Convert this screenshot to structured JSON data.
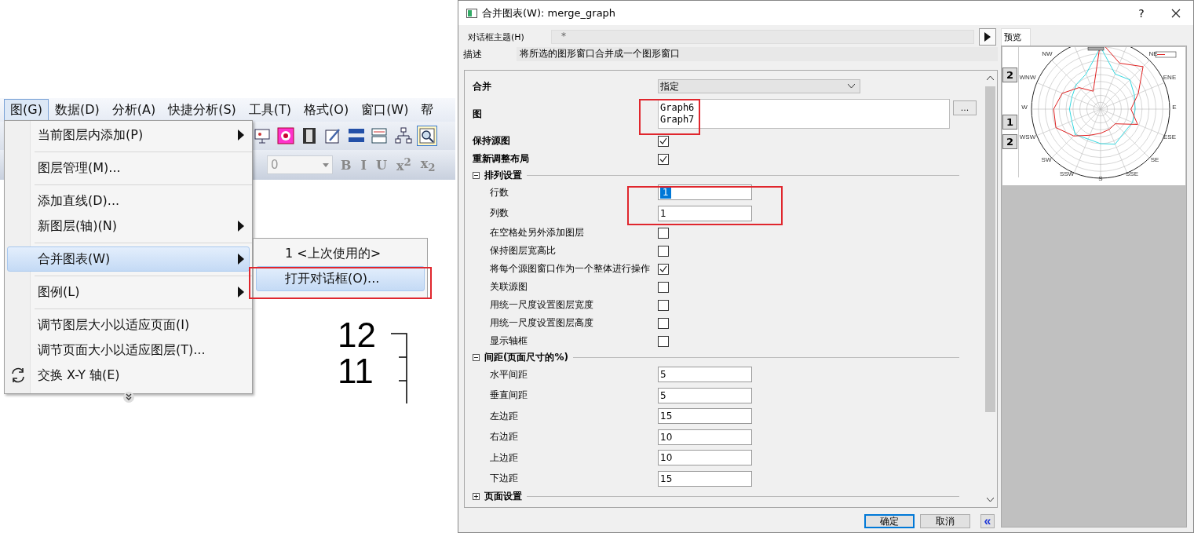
{
  "origin_screenshot": {
    "menu_bar": [
      {
        "label": "图(G)",
        "selected": true
      },
      {
        "label": "数据(D)",
        "selected": false
      },
      {
        "label": "分析(A)",
        "selected": false
      },
      {
        "label": "快捷分析(S)",
        "selected": false
      },
      {
        "label": "工具(T)",
        "selected": false
      },
      {
        "label": "格式(O)",
        "selected": false
      },
      {
        "label": "窗口(W)",
        "selected": false
      },
      {
        "label": "帮",
        "selected": false
      }
    ],
    "font_size_field": "0",
    "format_buttons": [
      "B",
      "I",
      "U",
      "x$^{2}$",
      "x$_{2}$"
    ],
    "graph_menu": [
      {
        "kind": "item",
        "label": "当前图层内添加(P)",
        "submenu": true,
        "selected": false
      },
      {
        "kind": "separator"
      },
      {
        "kind": "item",
        "label": "图层管理(M)...",
        "submenu": false,
        "selected": false
      },
      {
        "kind": "separator"
      },
      {
        "kind": "item",
        "label": "添加直线(D)...",
        "submenu": false,
        "selected": false
      },
      {
        "kind": "item",
        "label": "新图层(轴)(N)",
        "submenu": true,
        "selected": false
      },
      {
        "kind": "separator"
      },
      {
        "kind": "item",
        "label": "合并图表(W)",
        "submenu": true,
        "selected": true
      },
      {
        "kind": "separator"
      },
      {
        "kind": "item",
        "label": "图例(L)",
        "submenu": true,
        "selected": false
      },
      {
        "kind": "separator"
      },
      {
        "kind": "item",
        "label": "调节图层大小以适应页面(I)",
        "submenu": false,
        "selected": false
      },
      {
        "kind": "item",
        "label": "调节页面大小以适应图层(T)...",
        "submenu": false,
        "selected": false
      },
      {
        "kind": "iconitem",
        "label": "交换 X-Y 轴(E)",
        "submenu": false,
        "selected": false
      },
      {
        "kind": "more"
      }
    ],
    "submenu": [
      {
        "label": "1 <上次使用的>",
        "selected": false
      },
      {
        "label": "打开对话框(O)...",
        "selected": true
      }
    ],
    "axis_labels": [
      "12",
      "11"
    ]
  },
  "dialog": {
    "title": "合并图表(W): merge_graph",
    "help": "?",
    "theme_label": "对话框主题(H)",
    "theme_value": "*",
    "description_label": "描述",
    "description": "将所选的图形窗口合并成一个图形窗口",
    "settings": [
      {
        "kind": "dropdown",
        "label": "合并",
        "value": "指定"
      },
      {
        "kind": "list",
        "label": "图",
        "items": [
          "Graph6",
          "Graph7"
        ],
        "button": "..."
      },
      {
        "kind": "checkbox",
        "label": "保持源图",
        "bold": true,
        "checked": true
      },
      {
        "kind": "checkbox",
        "label": "重新调整布局",
        "bold": true,
        "checked": true
      },
      {
        "kind": "section",
        "label": "排列设置",
        "expanded": true
      },
      {
        "kind": "input",
        "label": "行数",
        "value": "1",
        "text_selected": true
      },
      {
        "kind": "input",
        "label": "列数",
        "value": "1",
        "text_selected": false
      },
      {
        "kind": "checkbox",
        "label": "在空格处另外添加图层",
        "bold": false,
        "checked": false
      },
      {
        "kind": "checkbox",
        "label": "保持图层宽高比",
        "bold": false,
        "checked": false
      },
      {
        "kind": "checkbox",
        "label": "将每个源图窗口作为一个整体进行操作",
        "bold": false,
        "checked": true
      },
      {
        "kind": "checkbox",
        "label": "关联源图",
        "bold": false,
        "checked": false
      },
      {
        "kind": "checkbox",
        "label": "用统一尺度设置图层宽度",
        "bold": false,
        "checked": false
      },
      {
        "kind": "checkbox",
        "label": "用统一尺度设置图层高度",
        "bold": false,
        "checked": false
      },
      {
        "kind": "checkbox",
        "label": "显示轴框",
        "bold": false,
        "checked": false
      },
      {
        "kind": "section",
        "label": "间距(页面尺寸的%)",
        "expanded": true
      },
      {
        "kind": "input",
        "label": "水平间距",
        "value": "5",
        "text_selected": false
      },
      {
        "kind": "input",
        "label": "垂直间距",
        "value": "5",
        "text_selected": false
      },
      {
        "kind": "input",
        "label": "左边距",
        "value": "15",
        "text_selected": false
      },
      {
        "kind": "input",
        "label": "右边距",
        "value": "10",
        "text_selected": false
      },
      {
        "kind": "input",
        "label": "上边距",
        "value": "10",
        "text_selected": false
      },
      {
        "kind": "input",
        "label": "下边距",
        "value": "15",
        "text_selected": false
      },
      {
        "kind": "section",
        "label": "页面设置",
        "expanded": false
      }
    ],
    "ok": "确定",
    "cancel": "取消",
    "collapse": "«",
    "preview": {
      "tab": "预览",
      "layer_buttons": [
        "2",
        "1",
        "2"
      ],
      "direction_labels": [
        "NW",
        "NE",
        "WNW",
        "ENE",
        "W",
        "E",
        "WSW",
        "ESE",
        "SW",
        "SE",
        "SSW",
        "S",
        "SSE"
      ]
    }
  }
}
